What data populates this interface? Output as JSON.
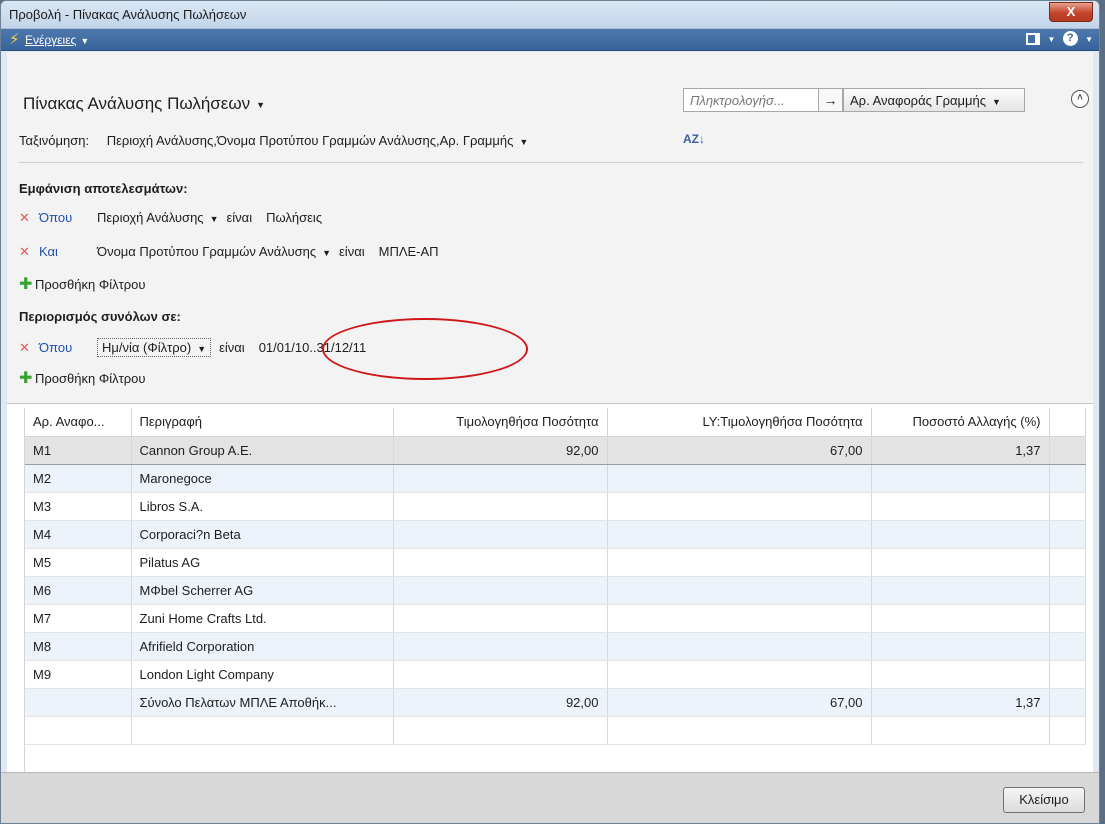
{
  "window": {
    "title": "Προβολή - Πίνακας Ανάλυσης Πωλήσεων",
    "close_glyph": "X"
  },
  "actionbar": {
    "actions_label": "Ενέργειες",
    "help_glyph": "?"
  },
  "header": {
    "page_title": "Πίνακας Ανάλυσης Πωλήσεων",
    "search_placeholder": "Πληκτρολογήσ...",
    "search_field": "Αρ. Αναφοράς Γραμμής",
    "sort_label": "Ταξινόμηση:",
    "sort_value": "Περιοχή Ανάλυσης,Όνομα Προτύπου Γραμμών Ανάλυσης,Αρ. Γραμμής"
  },
  "filters": {
    "show_results_title": "Εμφάνιση αποτελεσμάτων:",
    "rows": [
      {
        "conj": "Όπου",
        "field": "Περιοχή Ανάλυσης",
        "op": "είναι",
        "value": "Πωλήσεις"
      },
      {
        "conj": "Και",
        "field": "Όνομα Προτύπου Γραμμών Ανάλυσης",
        "op": "είναι",
        "value": "ΜΠΛΕ-ΑΠ"
      }
    ],
    "add_filter_label": "Προσθήκη Φίλτρου",
    "limit_totals_title": "Περιορισμός συνόλων σε:",
    "limit_row": {
      "conj": "Όπου",
      "field": "Ημ/νία (Φίλτρο)",
      "op": "είναι",
      "value": "01/01/10..31/12/11"
    },
    "add_filter_label_2": "Προσθήκη Φίλτρου"
  },
  "grid": {
    "columns": [
      "Αρ. Αναφο...",
      "Περιγραφή",
      "Τιμολογηθήσα Ποσότητα",
      "LY:Τιμολογηθήσα Ποσότητα",
      "Ποσοστό Αλλαγής (%)"
    ],
    "rows": [
      {
        "no": "M1",
        "desc": "Cannon Group A.E.",
        "qty": "92,00",
        "ly": "67,00",
        "pct": "1,37"
      },
      {
        "no": "M2",
        "desc": "Maronegoce",
        "qty": "",
        "ly": "",
        "pct": ""
      },
      {
        "no": "M3",
        "desc": "Libros S.A.",
        "qty": "",
        "ly": "",
        "pct": ""
      },
      {
        "no": "M4",
        "desc": "Corporaci?n Beta",
        "qty": "",
        "ly": "",
        "pct": ""
      },
      {
        "no": "M5",
        "desc": "Pilatus AG",
        "qty": "",
        "ly": "",
        "pct": ""
      },
      {
        "no": "M6",
        "desc": "MΦbel Scherrer AG",
        "qty": "",
        "ly": "",
        "pct": ""
      },
      {
        "no": "M7",
        "desc": "Zuni Home Crafts Ltd.",
        "qty": "",
        "ly": "",
        "pct": ""
      },
      {
        "no": "M8",
        "desc": "Afrifield Corporation",
        "qty": "",
        "ly": "",
        "pct": ""
      },
      {
        "no": "M9",
        "desc": "London Light Company",
        "qty": "",
        "ly": "",
        "pct": ""
      },
      {
        "no": "",
        "desc": "Σύνολο Πελατων ΜΠΛΕ Αποθήκ...",
        "qty": "92,00",
        "ly": "67,00",
        "pct": "1,37"
      }
    ]
  },
  "footer": {
    "close_label": "Κλείσιμο"
  }
}
